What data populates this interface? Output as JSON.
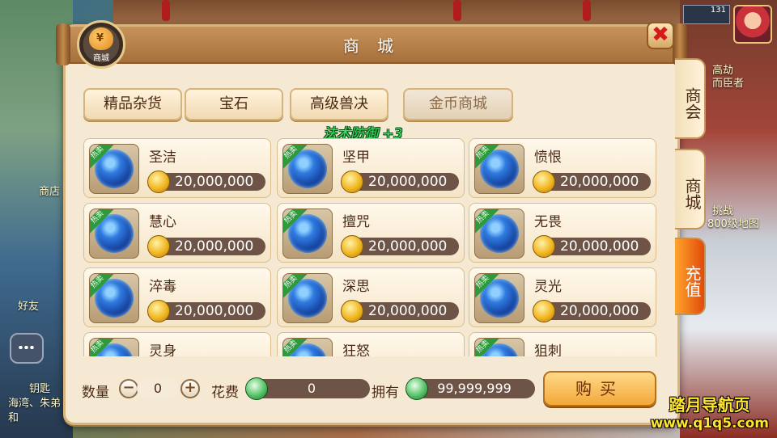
{
  "background": {
    "left_labels": [
      "商店",
      "好友",
      "钥匙",
      "海湾、朱弟",
      "和"
    ],
    "right_labels": [
      "高劫",
      "而臣者",
      "挑战",
      "800级地图"
    ],
    "level": "131",
    "chat_icon": "chat-bubble-icon"
  },
  "panel": {
    "title": "商 城",
    "badge_label": "商城",
    "badge_symbol": "¥",
    "close_symbol": "✖"
  },
  "categories": [
    "精品杂货",
    "宝石",
    "高级兽决",
    "金币商城"
  ],
  "buff_text": "法术防御 +3",
  "item_ribbon": "热卖",
  "items": [
    {
      "name": "圣洁",
      "price": "20,000,000"
    },
    {
      "name": "坚甲",
      "price": "20,000,000"
    },
    {
      "name": "愤恨",
      "price": "20,000,000"
    },
    {
      "name": "慧心",
      "price": "20,000,000"
    },
    {
      "name": "擅咒",
      "price": "20,000,000"
    },
    {
      "name": "无畏",
      "price": "20,000,000"
    },
    {
      "name": "淬毒",
      "price": "20,000,000"
    },
    {
      "name": "深思",
      "price": "20,000,000"
    },
    {
      "name": "灵光",
      "price": "20,000,000"
    },
    {
      "name": "灵身",
      "price": ""
    },
    {
      "name": "狂怒",
      "price": ""
    },
    {
      "name": "狙刺",
      "price": ""
    }
  ],
  "bottom": {
    "qty_label": "数量",
    "qty_value": "0",
    "minus": "−",
    "plus": "+",
    "cost_label": "花费",
    "cost_value": "0",
    "own_label": "拥有",
    "own_value": "99,999,999",
    "buy_label": "购买"
  },
  "side_tabs": [
    "商会",
    "商城",
    "充值"
  ],
  "watermark": {
    "line1": "踏月导航页",
    "line2": "www.q1q5.com"
  }
}
